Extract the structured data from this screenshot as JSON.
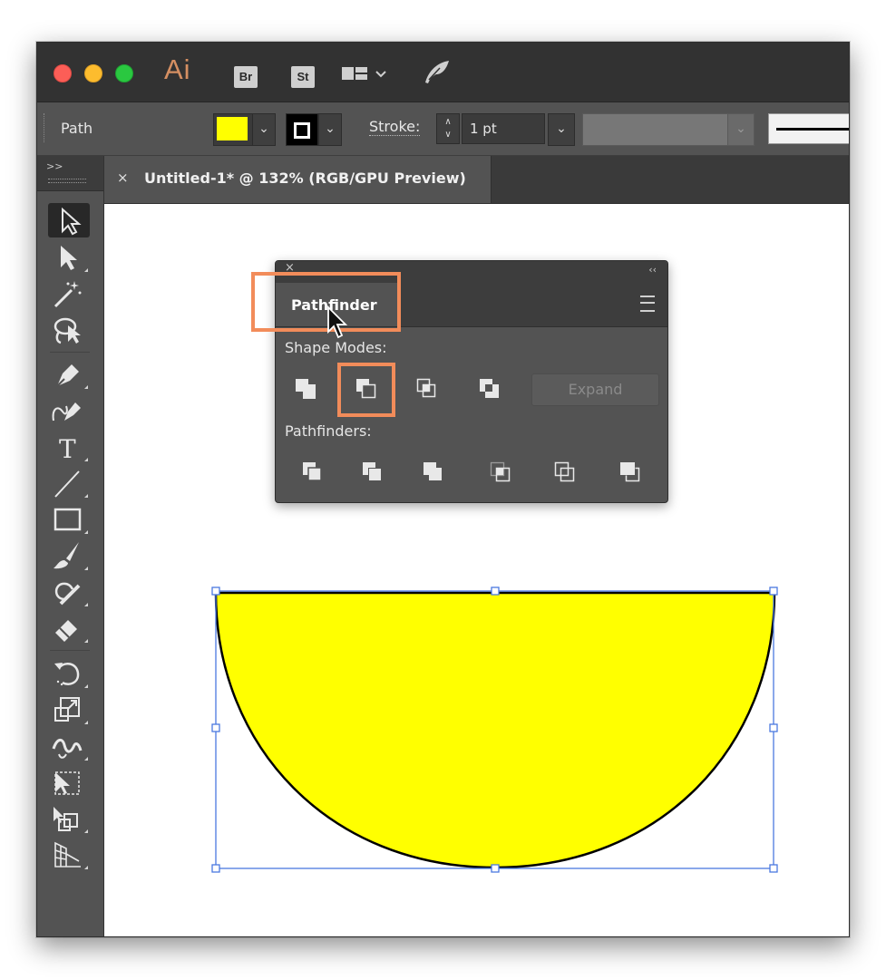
{
  "app": {
    "name": "Ai",
    "bridge_label": "Br",
    "stock_label": "St",
    "workspace_icon": "workspace-layout-icon",
    "feather_icon": "feather-icon"
  },
  "control_bar": {
    "selection_type": "Path",
    "fill_color": "#ffff00",
    "stroke_label": "Stroke:",
    "stroke_weight": "1 pt"
  },
  "toolbar": {
    "collapse_label": ">>",
    "tools": [
      "selection-tool",
      "direct-selection-tool",
      "magic-wand-tool",
      "lasso-tool",
      "pen-tool",
      "curvature-tool",
      "type-tool",
      "line-segment-tool",
      "rectangle-tool",
      "paintbrush-tool",
      "shaper-tool",
      "eraser-tool",
      "rotate-tool",
      "scale-tool",
      "width-tool",
      "free-transform-tool",
      "shape-builder-tool",
      "perspective-grid-tool"
    ]
  },
  "document": {
    "close_label": "×",
    "tab_title": "Untitled-1* @ 132% (RGB/GPU Preview)"
  },
  "pathfinder_panel": {
    "close_label": "×",
    "collapse_label": "‹‹",
    "tab_label": "Pathfinder",
    "shape_modes_label": "Shape Modes:",
    "shape_modes": [
      "unite",
      "minus-front",
      "intersect",
      "exclude"
    ],
    "expand_label": "Expand",
    "pathfinders_label": "Pathfinders:",
    "pathfinders": [
      "divide",
      "trim",
      "merge",
      "crop",
      "outline",
      "minus-back"
    ]
  },
  "artwork": {
    "shape": "half-circle",
    "fill_color": "#ffff00",
    "stroke_color": "#000000",
    "selection_color": "#4a78e0"
  },
  "highlight_color": "#f28c5a"
}
